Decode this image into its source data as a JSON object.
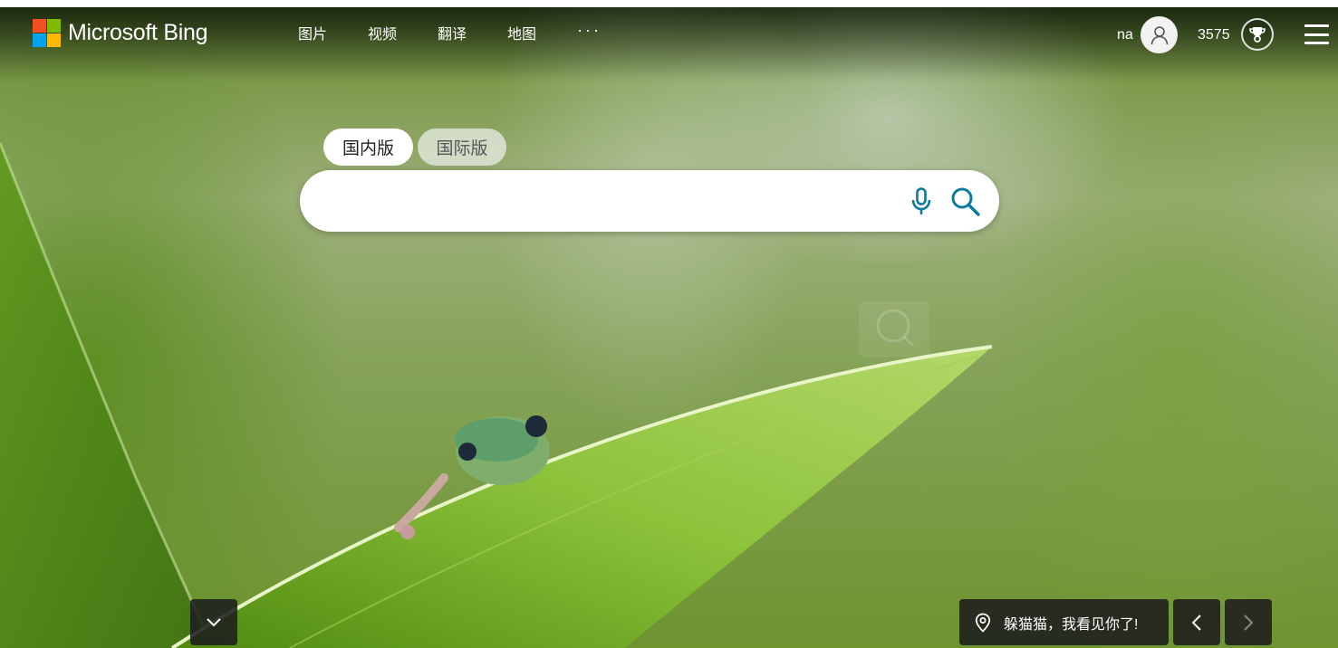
{
  "header": {
    "logo_text": "Microsoft Bing",
    "nav": [
      {
        "label": "图片"
      },
      {
        "label": "视频"
      },
      {
        "label": "翻译"
      },
      {
        "label": "地图"
      },
      {
        "label": "···"
      }
    ],
    "user_name": "na",
    "points": "3575",
    "icons": {
      "avatar": "person-icon",
      "rewards": "trophy-icon",
      "menu": "hamburger-menu-icon"
    }
  },
  "search": {
    "tabs": [
      {
        "label": "国内版",
        "selected": true
      },
      {
        "label": "国际版",
        "selected": false
      }
    ],
    "value": "",
    "placeholder": "",
    "icons": {
      "mic": "microphone-icon",
      "search": "search-icon"
    }
  },
  "footer": {
    "caption": "躲猫猫，我看见你了!",
    "icons": {
      "scroll": "chevron-down-icon",
      "location": "location-pin-icon",
      "prev": "chevron-left-icon",
      "next": "chevron-right-icon"
    }
  },
  "colors": {
    "logo_red": "#f25022",
    "logo_green": "#7fba00",
    "logo_blue": "#00a4ef",
    "logo_yellow": "#ffb900",
    "accent": "#0b7a9c"
  }
}
